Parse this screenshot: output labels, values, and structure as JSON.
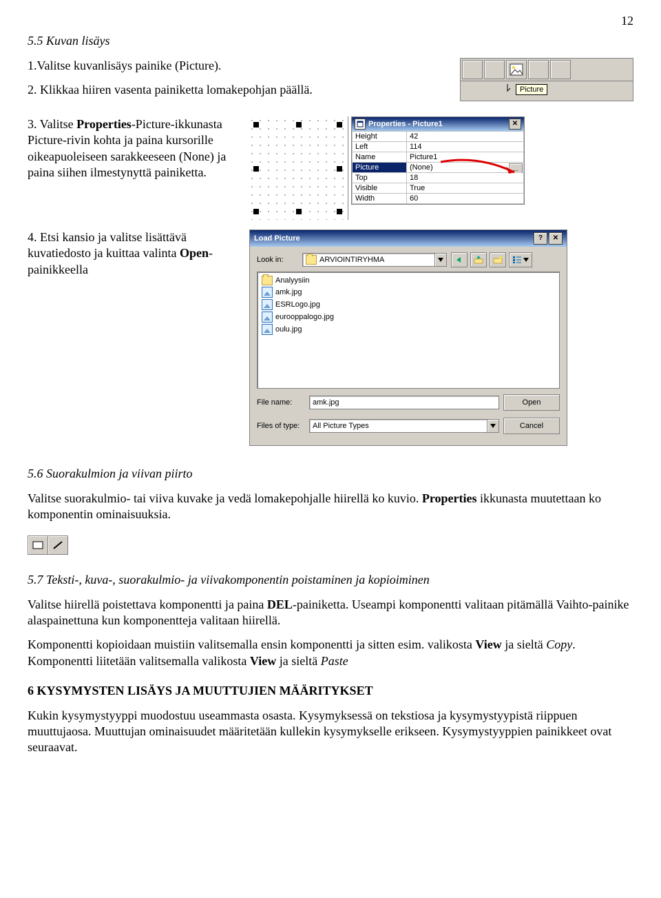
{
  "page_number": "12",
  "section55_title": "5.5 Kuvan lisäys",
  "step1": "1.Valitse kuvanlisäys painike (Picture).",
  "step2": "2. Klikkaa hiiren vasenta painiketta lomakepohjan päällä.",
  "step3_a": "3. Valitse ",
  "step3_bold1": "Properties",
  "step3_b": "-Picture-ikkunasta Picture-rivin kohta ja paina kursorille oikeapuoleiseen sarakkeeseen (None) ja paina siihen ilmestynyttä painiketta.",
  "step4_a": "4. Etsi kansio ja valitse lisättävä kuvatiedosto ja kuittaa valinta ",
  "step4_bold": "Open",
  "step4_b": "-painikkeella",
  "tooltip_label": "Picture",
  "properties_title": "Properties - Picture1",
  "properties": [
    {
      "key": "Height",
      "val": "42"
    },
    {
      "key": "Left",
      "val": "114"
    },
    {
      "key": "Name",
      "val": "Picture1"
    },
    {
      "key": "Picture",
      "val": "(None)",
      "selected": true,
      "button": true
    },
    {
      "key": "Top",
      "val": "18"
    },
    {
      "key": "Visible",
      "val": "True"
    },
    {
      "key": "Width",
      "val": "60"
    }
  ],
  "ellipsis_label": "...",
  "dlg_title": "Load Picture",
  "dlg_lookin_label": "Look in:",
  "dlg_folder": "ARVIOINTIRYHMA",
  "dlg_files": [
    {
      "type": "folder",
      "name": "Analyysiin"
    },
    {
      "type": "image",
      "name": "amk.jpg"
    },
    {
      "type": "image",
      "name": "ESRLogo.jpg"
    },
    {
      "type": "image",
      "name": "eurooppalogo.jpg"
    },
    {
      "type": "image",
      "name": "oulu.jpg"
    }
  ],
  "dlg_filename_label": "File name:",
  "dlg_filename_value": "amk.jpg",
  "dlg_filetype_label": "Files of type:",
  "dlg_filetype_value": "All Picture Types",
  "dlg_open": "Open",
  "dlg_cancel": "Cancel",
  "section56_title": "5.6 Suorakulmion ja viivan piirto",
  "section56_p_a": "Valitse suorakulmio- tai viiva kuvake ja vedä lomakepohjalle hiirellä ko kuvio. ",
  "section56_bold": "Properties",
  "section56_p_b": " ikkunasta muutettaan ko komponentin ominaisuuksia.",
  "section57_title": "5.7 Teksti-, kuva-, suorakulmio- ja viivakomponentin poistaminen ja kopioiminen",
  "section57_p1_a": "Valitse hiirellä poistettava komponentti ja paina ",
  "section57_p1_bold": "DEL",
  "section57_p1_b": "-painiketta. Useampi komponentti valitaan pitämällä Vaihto-painike alaspainettuna kun komponentteja valitaan hiirellä.",
  "section57_p2_a": "Komponentti kopioidaan muistiin valitsemalla ensin komponentti ja sitten esim. valikosta ",
  "section57_p2_bold": "View",
  "section57_p2_b": " ja sieltä ",
  "section57_p2_ital": "Copy",
  "section57_p2_c": ".",
  "section57_p3_a": "Komponentti liitetään valitsemalla valikosta ",
  "section57_p3_bold": "View",
  "section57_p3_b": " ja sieltä ",
  "section57_p3_ital": "Paste",
  "heading6": "6 KYSYMYSTEN LISÄYS JA MUUTTUJIEN MÄÄRITYKSET",
  "section6_p": "Kukin  kysymystyyppi muodostuu useammasta osasta. Kysymyksessä on tekstiosa ja kysymystyypistä riippuen muuttujaosa. Muuttujan ominaisuudet määritetään kullekin kysymykselle erikseen. Kysymystyyppien painikkeet  ovat seuraavat."
}
